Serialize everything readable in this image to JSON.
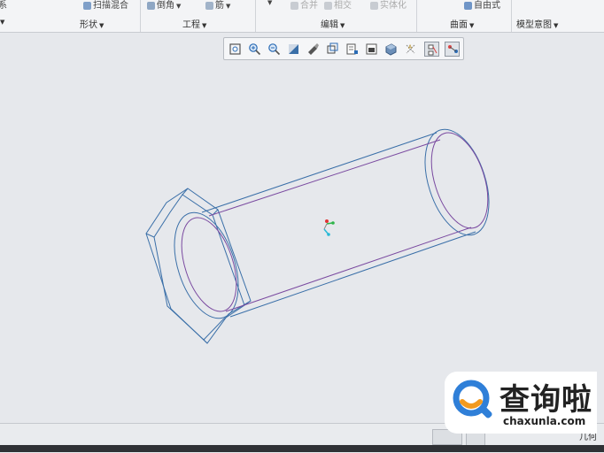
{
  "ribbon": {
    "top_items": [
      {
        "label": "扫描混合",
        "icon": "sweep-blend-icon"
      },
      {
        "label": "倒角",
        "icon": "chamfer-icon"
      },
      {
        "label": "筋",
        "icon": "rib-icon"
      },
      {
        "label": "合并",
        "icon": "merge-icon"
      },
      {
        "label": "相交",
        "icon": "intersect-icon"
      },
      {
        "label": "实体化",
        "icon": "solidify-icon"
      },
      {
        "label": "自由式",
        "icon": "freestyle-icon"
      }
    ],
    "groups": [
      {
        "label": "形状"
      },
      {
        "label": "工程"
      },
      {
        "label": "编辑"
      },
      {
        "label": "曲面"
      },
      {
        "label": "模型意图"
      }
    ]
  },
  "view_toolbar": {
    "buttons": [
      {
        "icon": "refit-icon"
      },
      {
        "icon": "zoom-in-icon"
      },
      {
        "icon": "zoom-out-icon"
      },
      {
        "icon": "repaint-icon"
      },
      {
        "icon": "view-orientation-icon"
      },
      {
        "icon": "saved-views-icon"
      },
      {
        "icon": "view-manager-icon"
      },
      {
        "icon": "perspective-icon"
      },
      {
        "icon": "display-style-icon"
      },
      {
        "icon": "datum-display-icon"
      },
      {
        "icon": "annotation-display-icon"
      },
      {
        "icon": "spin-center-icon"
      }
    ]
  },
  "status_bar": {
    "right_label": "几何"
  },
  "watermark": {
    "brand_cn": "查询啦",
    "brand_url": "chaxunla.com",
    "colors": {
      "blue": "#2f7fd8",
      "orange": "#f29a1f"
    }
  },
  "colors": {
    "model_edge": "#3a6fa8",
    "model_inner": "#7a4aa0",
    "background": "#e6e8ec"
  }
}
